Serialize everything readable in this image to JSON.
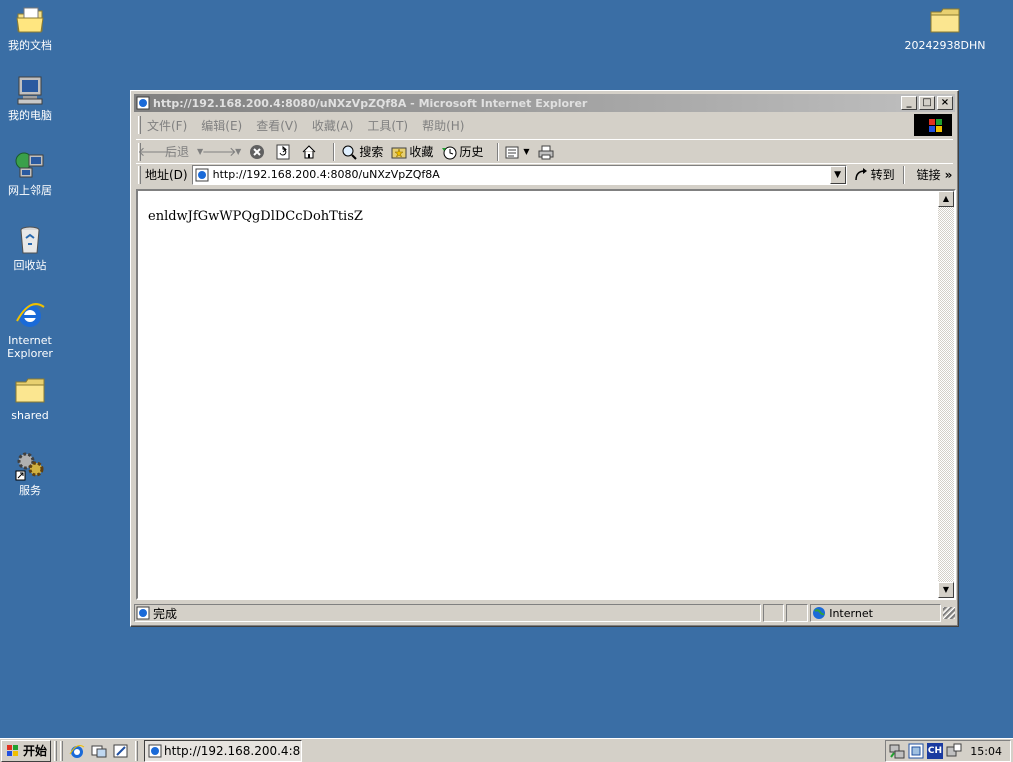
{
  "desktop": {
    "icons": [
      {
        "label": "我的文档",
        "icon": "my-documents-icon"
      },
      {
        "label": "我的电脑",
        "icon": "my-computer-icon"
      },
      {
        "label": "网上邻居",
        "icon": "network-places-icon"
      },
      {
        "label": "回收站",
        "icon": "recycle-bin-icon"
      },
      {
        "label": "Internet Explorer",
        "icon": "internet-explorer-icon"
      },
      {
        "label": "shared",
        "icon": "folder-icon"
      },
      {
        "label": "服务",
        "icon": "services-icon"
      }
    ],
    "folder_right": {
      "label": "20242938DHN",
      "icon": "folder-icon"
    }
  },
  "window": {
    "title": "http://192.168.200.4:8080/uNXzVpZQf8A - Microsoft Internet Explorer",
    "menu": [
      "文件(F)",
      "编辑(E)",
      "查看(V)",
      "收藏(A)",
      "工具(T)",
      "帮助(H)"
    ],
    "toolbar": {
      "back": "后退",
      "search": "搜索",
      "favorites": "收藏",
      "history": "历史"
    },
    "address": {
      "label": "地址(D)",
      "url": "http://192.168.200.4:8080/uNXzVpZQf8A",
      "go": "转到",
      "links": "链接"
    },
    "page_text": "enldwJfGwWPQgDlDCcDohTtisZ",
    "status": {
      "text": "完成",
      "zone": "Internet"
    }
  },
  "taskbar": {
    "start": "开始",
    "task": "http://192.168.200.4:80...",
    "lang": "CH",
    "clock": "15:04"
  },
  "colors": {
    "desktop": "#3a6ea5",
    "face": "#d4d0c8"
  }
}
